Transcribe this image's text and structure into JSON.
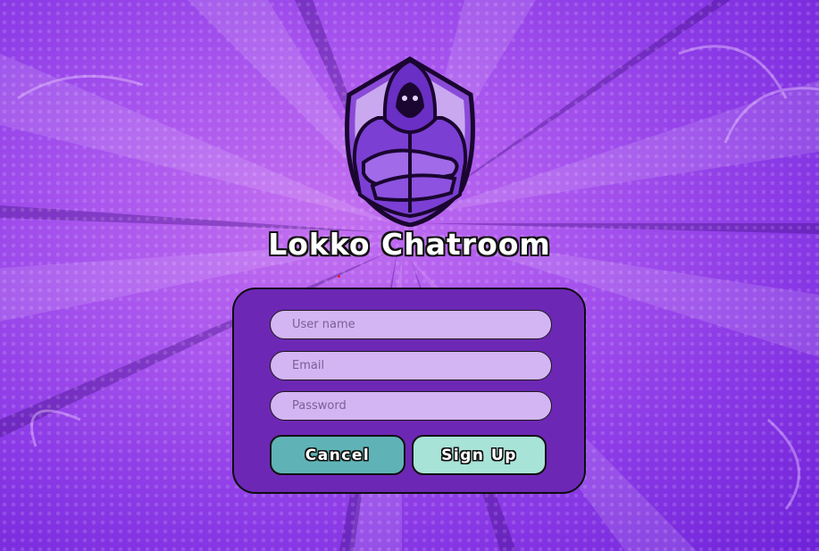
{
  "app": {
    "title": "Lokko Chatroom"
  },
  "logo": {
    "icon": "hooded-figure-shield-logo"
  },
  "form": {
    "username": {
      "placeholder": "User name",
      "value": ""
    },
    "email": {
      "placeholder": "Email",
      "value": ""
    },
    "password": {
      "placeholder": "Password",
      "value": ""
    },
    "cancel_label": "Cancel",
    "signup_label": "Sign Up"
  },
  "colors": {
    "background": "#a855ee",
    "panel": "#6d27b5",
    "input": "#d4b5f4",
    "cancel_button": "#5fb3b6",
    "signup_button": "#a8e3d7"
  }
}
